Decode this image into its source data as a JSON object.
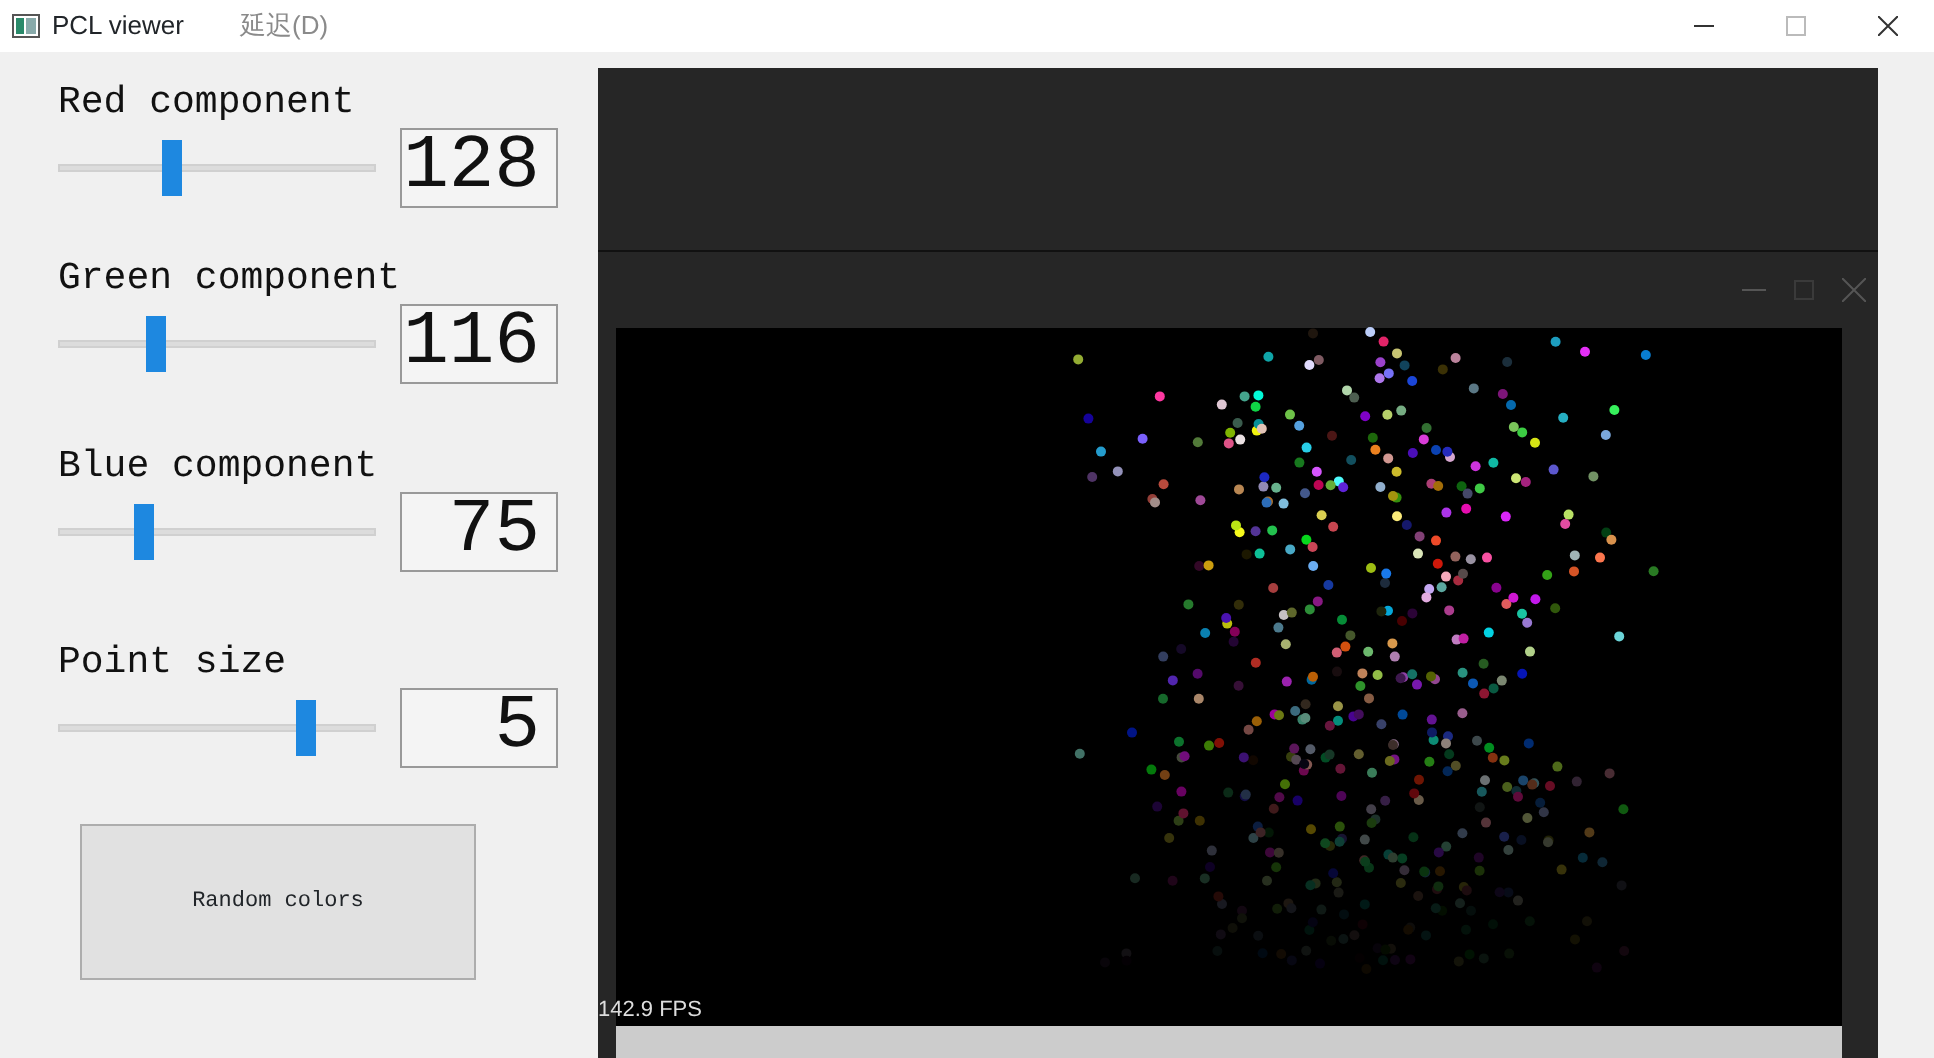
{
  "window": {
    "title": "PCL viewer",
    "toolbar_text": "延迟(D)"
  },
  "controls": [
    {
      "label": "Red component",
      "level": 0.36,
      "reading": "128"
    },
    {
      "label": "Green component",
      "level": 0.31,
      "reading": "116"
    },
    {
      "label": "Blue component",
      "level": 0.27,
      "reading": "75"
    },
    {
      "label": "Point size",
      "level": 0.78,
      "reading": "5"
    }
  ],
  "random_button": {
    "label": "Random colors"
  },
  "viewer": {
    "fps": "142.9 FPS"
  }
}
